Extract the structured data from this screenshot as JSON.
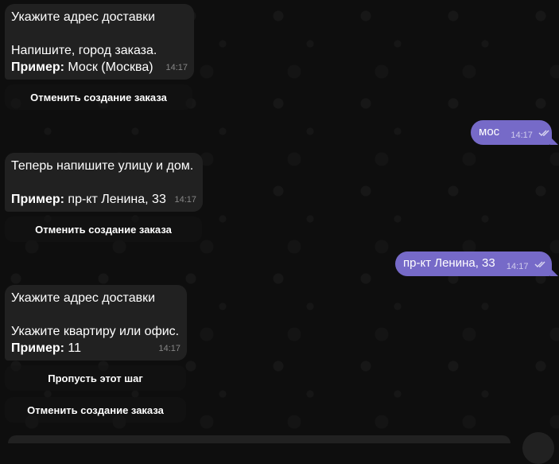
{
  "messages": [
    {
      "lines": [
        "Укажите адрес доставки",
        "",
        "Напишите, город заказа."
      ],
      "example_label": "Пример:",
      "example_value": "Моск (Москва)",
      "time": "14:17"
    },
    {
      "lines": [
        "Теперь напишите улицу и дом.",
        ""
      ],
      "example_label": "Пример:",
      "example_value": "пр-кт Ленина, 33",
      "time": "14:17"
    },
    {
      "lines": [
        "Укажите адрес доставки",
        "",
        "Укажите квартиру или офис."
      ],
      "example_label": "Пример:",
      "example_value": "11",
      "time": "14:17"
    }
  ],
  "outgoing": [
    {
      "text": "мос",
      "time": "14:17"
    },
    {
      "text": "пр-кт Ленина, 33",
      "time": "14:17"
    }
  ],
  "buttons": {
    "cancel_order_1": "Отменить создание заказа",
    "cancel_order_2": "Отменить создание заказа",
    "skip_step": "Пропусть этот шаг",
    "cancel_order_3": "Отменить создание заказа"
  },
  "colors": {
    "background": "#0e0e0e",
    "incoming_bubble": "#212121",
    "outgoing_bubble": "#766ac8"
  }
}
